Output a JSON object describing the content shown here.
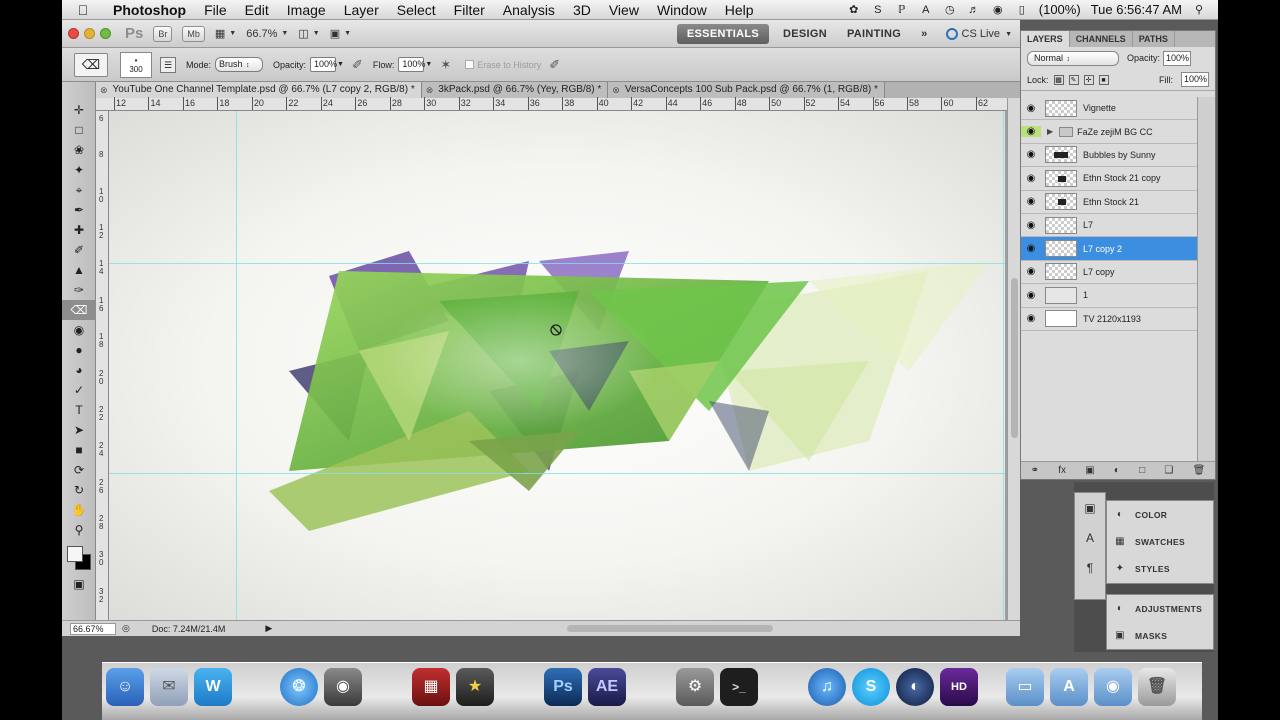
{
  "menubar": {
    "app_name": "Photoshop",
    "items": [
      "File",
      "Edit",
      "Image",
      "Layer",
      "Select",
      "Filter",
      "Analysis",
      "3D",
      "View",
      "Window",
      "Help"
    ],
    "battery": "(100%)",
    "clock": "Tue 6:56:47 AM"
  },
  "appbar": {
    "logo": "Ps",
    "bridge": "Br",
    "minibridge": "Mb",
    "zoom": "66.7%",
    "workspaces": [
      "ESSENTIALS",
      "DESIGN",
      "PAINTING"
    ],
    "more": "»",
    "cs_live": "CS Live"
  },
  "options": {
    "brush_size": "300",
    "mode_label": "Mode:",
    "mode_value": "Brush",
    "opacity_label": "Opacity:",
    "opacity_value": "100%",
    "flow_label": "Flow:",
    "flow_value": "100%",
    "erase_history": "Erase to History"
  },
  "tabs": [
    "YouTube One Channel Template.psd @ 66.7% (L7 copy 2, RGB/8) *",
    "3kPack.psd @ 66.7% (Yey, RGB/8) *",
    "VersaConcepts 100 Sub Pack.psd @ 66.7% (1, RGB/8) *"
  ],
  "ruler": {
    "h_labels": [
      "12",
      "14",
      "16",
      "18",
      "20",
      "22",
      "24",
      "26",
      "28",
      "30",
      "32",
      "34",
      "36",
      "38",
      "40",
      "42",
      "44",
      "46",
      "48",
      "50",
      "52",
      "54",
      "56",
      "58",
      "60",
      "62"
    ],
    "v_labels": [
      "6",
      "8",
      "1 0",
      "1 2",
      "1 4",
      "1 6",
      "1 8",
      "2 0",
      "2 2",
      "2 4",
      "2 6",
      "2 8",
      "3 0",
      "3 2"
    ]
  },
  "status": {
    "zoom": "66.67%",
    "doc": "Doc: 7.24M/21.4M"
  },
  "layers_panel": {
    "tabs": [
      "LAYERS",
      "CHANNELS",
      "PATHS"
    ],
    "blend_mode": "Normal",
    "opacity_label": "Opacity:",
    "opacity": "100%",
    "lock_label": "Lock:",
    "fill_label": "Fill:",
    "fill": "100%",
    "layers": [
      {
        "name": "Vignette"
      },
      {
        "name": "FaZe zejiM BG CC"
      },
      {
        "name": "Bubbles by Sunny"
      },
      {
        "name": "Ethn Stock 21 copy"
      },
      {
        "name": "Ethn Stock 21"
      },
      {
        "name": "L7"
      },
      {
        "name": "L7 copy 2"
      },
      {
        "name": "L7 copy"
      },
      {
        "name": "1"
      },
      {
        "name": "TV 2120x1193"
      }
    ],
    "selected_layer": "L7 copy 2"
  },
  "mini_panels": {
    "group1": [
      "COLOR",
      "SWATCHES",
      "STYLES"
    ],
    "group2": [
      "ADJUSTMENTS",
      "MASKS"
    ]
  },
  "dock": {
    "ps": "Ps",
    "ae": "AE"
  },
  "colors": {
    "accent_selection": "#3c8fe0",
    "guide": "#7fe0e8",
    "art_green": "#6cbf3a",
    "art_purple": "#7a5cb0"
  }
}
